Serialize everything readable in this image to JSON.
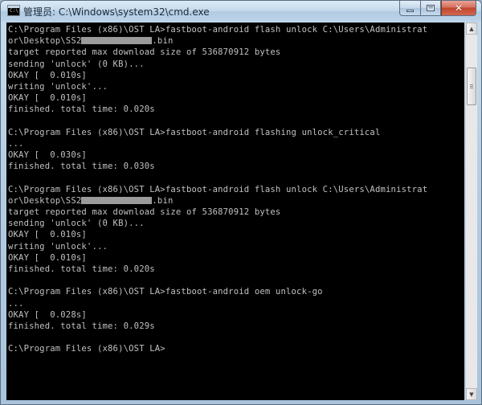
{
  "window": {
    "title": "管理员: C:\\Windows\\system32\\cmd.exe",
    "icon": "cmd-console-icon",
    "buttons": {
      "minimize": "minimize-icon",
      "maximize": "maximize-icon",
      "close": "✕"
    }
  },
  "console": {
    "lines": [
      {
        "text": "C:\\Program Files (x86)\\OST LA>fastboot-android flash unlock C:\\Users\\Administrat"
      },
      {
        "pre": "or\\Desktop\\SS2",
        "redacted": true,
        "post": ".bin"
      },
      {
        "text": "target reported max download size of 536870912 bytes"
      },
      {
        "text": "sending 'unlock' (0 KB)..."
      },
      {
        "text": "OKAY [  0.010s]"
      },
      {
        "text": "writing 'unlock'..."
      },
      {
        "text": "OKAY [  0.010s]"
      },
      {
        "text": "finished. total time: 0.020s"
      },
      {
        "text": ""
      },
      {
        "text": "C:\\Program Files (x86)\\OST LA>fastboot-android flashing unlock_critical"
      },
      {
        "text": "..."
      },
      {
        "text": "OKAY [  0.030s]"
      },
      {
        "text": "finished. total time: 0.030s"
      },
      {
        "text": ""
      },
      {
        "text": "C:\\Program Files (x86)\\OST LA>fastboot-android flash unlock C:\\Users\\Administrat"
      },
      {
        "pre": "or\\Desktop\\SS2",
        "redacted": true,
        "post": ".bin"
      },
      {
        "text": "target reported max download size of 536870912 bytes"
      },
      {
        "text": "sending 'unlock' (0 KB)..."
      },
      {
        "text": "OKAY [  0.010s]"
      },
      {
        "text": "writing 'unlock'..."
      },
      {
        "text": "OKAY [  0.010s]"
      },
      {
        "text": "finished. total time: 0.020s"
      },
      {
        "text": ""
      },
      {
        "text": "C:\\Program Files (x86)\\OST LA>fastboot-android oem unlock-go"
      },
      {
        "text": "..."
      },
      {
        "text": "OKAY [  0.028s]"
      },
      {
        "text": "finished. total time: 0.029s"
      },
      {
        "text": ""
      },
      {
        "text": "C:\\Program Files (x86)\\OST LA>"
      }
    ]
  },
  "scrollbar": {
    "up_arrow": "▲",
    "down_arrow": "▼"
  },
  "colors": {
    "console_bg": "#000000",
    "console_fg": "#c0c0c0",
    "close_button": "#c1452c"
  }
}
